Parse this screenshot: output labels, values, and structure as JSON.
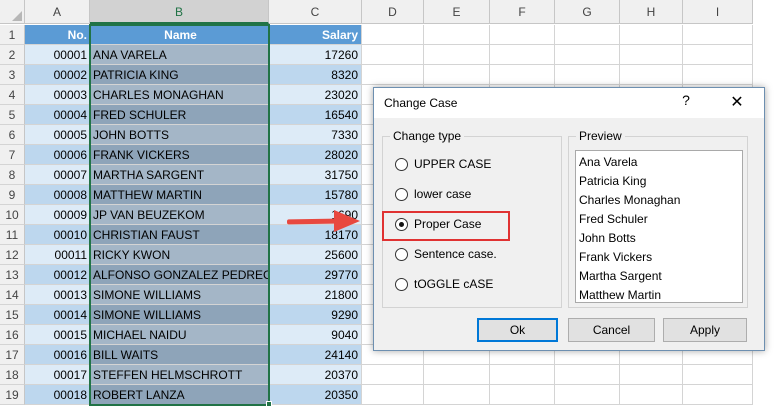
{
  "spreadsheet": {
    "columns": [
      "A",
      "B",
      "C",
      "D",
      "E",
      "F",
      "G",
      "H",
      "I"
    ],
    "selected_column": "B",
    "header_row": {
      "row": "1",
      "a": "No.",
      "b": "Name",
      "c": "Salary"
    },
    "rows": [
      {
        "row": "2",
        "a": "00001",
        "b": "ANA VARELA",
        "c": "17260"
      },
      {
        "row": "3",
        "a": "00002",
        "b": "PATRICIA KING",
        "c": "8320"
      },
      {
        "row": "4",
        "a": "00003",
        "b": "CHARLES MONAGHAN",
        "c": "23020"
      },
      {
        "row": "5",
        "a": "00004",
        "b": "FRED SCHULER",
        "c": "16540"
      },
      {
        "row": "6",
        "a": "00005",
        "b": "JOHN BOTTS",
        "c": "7330"
      },
      {
        "row": "7",
        "a": "00006",
        "b": "FRANK VICKERS",
        "c": "28020"
      },
      {
        "row": "8",
        "a": "00007",
        "b": "MARTHA SARGENT",
        "c": "31750"
      },
      {
        "row": "9",
        "a": "00008",
        "b": "MATTHEW MARTIN",
        "c": "15780"
      },
      {
        "row": "10",
        "a": "00009",
        "b": "JP VAN BEUZEKOM",
        "c": "1690"
      },
      {
        "row": "11",
        "a": "00010",
        "b": "CHRISTIAN FAUST",
        "c": "18170"
      },
      {
        "row": "12",
        "a": "00011",
        "b": "RICKY KWON",
        "c": "25600"
      },
      {
        "row": "13",
        "a": "00012",
        "b": "ALFONSO GONZALEZ PEDREGOSA",
        "c": "29770"
      },
      {
        "row": "14",
        "a": "00013",
        "b": "SIMONE WILLIAMS",
        "c": "21800"
      },
      {
        "row": "15",
        "a": "00014",
        "b": "SIMONE WILLIAMS",
        "c": "9290"
      },
      {
        "row": "16",
        "a": "00015",
        "b": "MICHAEL NAIDU",
        "c": "9040"
      },
      {
        "row": "17",
        "a": "00016",
        "b": "BILL WAITS",
        "c": "24140"
      },
      {
        "row": "18",
        "a": "00017",
        "b": "STEFFEN HELMSCHROTT",
        "c": "20370"
      },
      {
        "row": "19",
        "a": "00018",
        "b": "ROBERT LANZA",
        "c": "20350"
      }
    ],
    "colors": {
      "header_fill": "#5b9bd5",
      "band_light": "#ddebf7",
      "band_dark": "#bdd7ee",
      "selection": "#217346"
    }
  },
  "dialog": {
    "title": "Change Case",
    "help_icon": "?",
    "close_icon": "✕",
    "change_type": {
      "legend": "Change type",
      "options": [
        {
          "label": "UPPER CASE",
          "checked": false
        },
        {
          "label": "lower case",
          "checked": false
        },
        {
          "label": "Proper Case",
          "checked": true
        },
        {
          "label": "Sentence case.",
          "checked": false
        },
        {
          "label": "tOGGLE cASE",
          "checked": false
        }
      ]
    },
    "preview": {
      "legend": "Preview",
      "items": [
        "Ana Varela",
        "Patricia King",
        "Charles Monaghan",
        "Fred Schuler",
        "John Botts",
        "Frank Vickers",
        "Martha Sargent",
        "Matthew Martin"
      ]
    },
    "buttons": {
      "ok": "Ok",
      "cancel": "Cancel",
      "apply": "Apply"
    }
  },
  "annotation": {
    "arrow_color": "#e8483f",
    "highlight_color": "#e03232"
  }
}
